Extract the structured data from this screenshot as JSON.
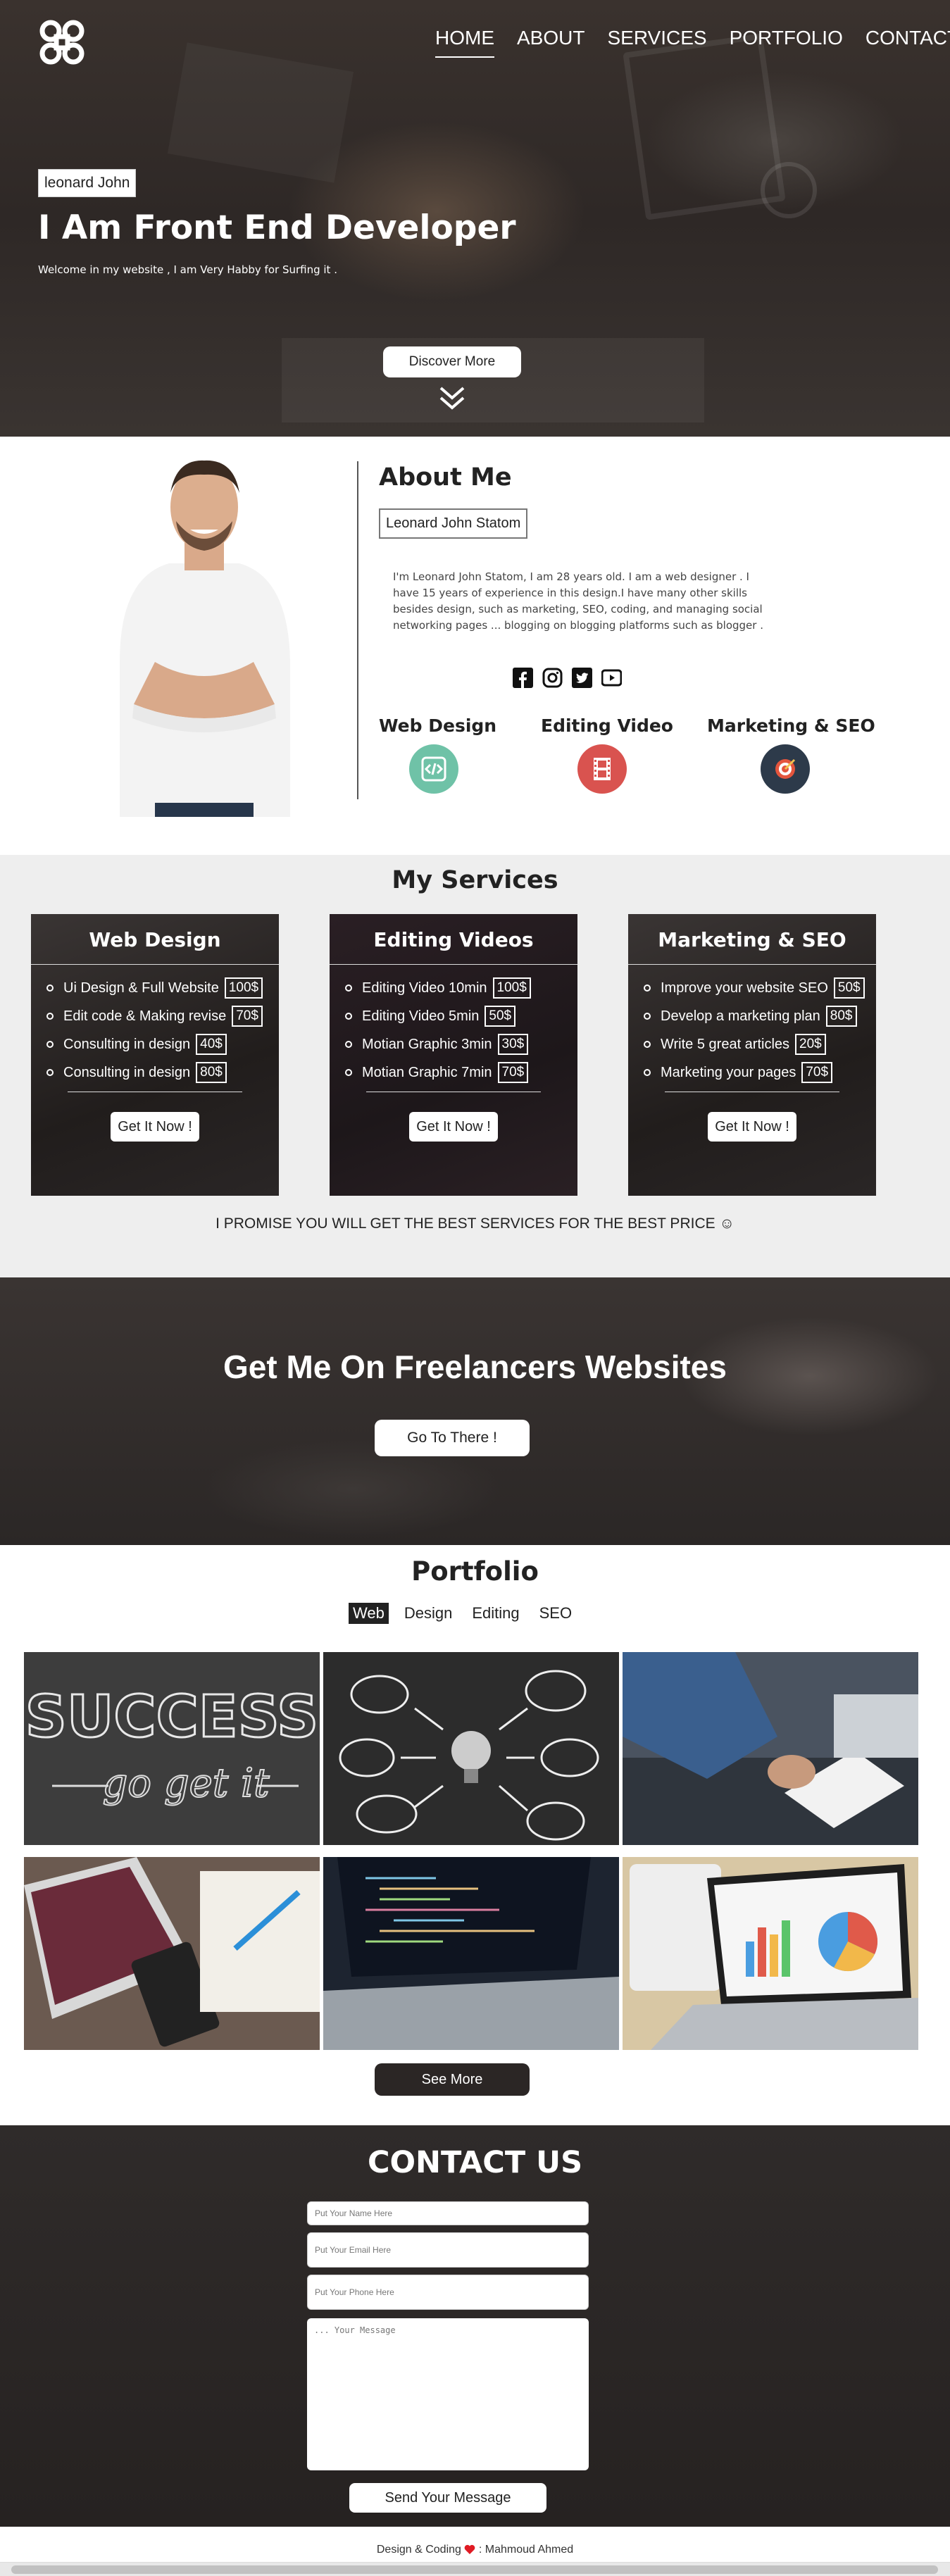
{
  "nav": {
    "items": [
      "HOME",
      "ABOUT",
      "SERVICES",
      "PORTFOLIO",
      "CONTACT"
    ],
    "active": "HOME"
  },
  "hero": {
    "name_badge": "leonard John",
    "title": "I Am Front End Developer",
    "subtitle": "Welcome in my website , I am Very Habby for Surfing it .",
    "button": "Discover More"
  },
  "about": {
    "heading": "About Me",
    "full_name": "Leonard John Statom",
    "bio": "I'm Leonard John Statom, I am 28 years old. I am a web designer . I have 15 years of experience in this design.I have many other skills besides design, such as marketing, SEO, coding, and managing social networking pages ... blogging on blogging platforms such as blogger .",
    "socials": [
      "facebook-icon",
      "instagram-icon",
      "twitter-icon",
      "youtube-icon"
    ],
    "skills": [
      {
        "label": "Web Design",
        "icon": "code-icon",
        "color": "#6fc2a7"
      },
      {
        "label": "Editing Video",
        "icon": "film-icon",
        "color": "#d9534f"
      },
      {
        "label": "Marketing & SEO",
        "icon": "target-icon",
        "color": "#2d3a4a"
      }
    ]
  },
  "services": {
    "title": "My Services",
    "cards": [
      {
        "title": "Web Design",
        "items": [
          {
            "name": "Ui Design & Full Website",
            "price": "100$"
          },
          {
            "name": "Edit code & Making revise",
            "price": "70$"
          },
          {
            "name": "Consulting in design",
            "price": "40$"
          },
          {
            "name": "Consulting in design",
            "price": "80$"
          }
        ],
        "button": "Get It Now !"
      },
      {
        "title": "Editing Videos",
        "items": [
          {
            "name": "Editing Video 10min",
            "price": "100$"
          },
          {
            "name": "Editing Video 5min",
            "price": "50$"
          },
          {
            "name": "Motian Graphic 3min",
            "price": "30$"
          },
          {
            "name": "Motian Graphic 7min",
            "price": "70$"
          }
        ],
        "button": "Get It Now !"
      },
      {
        "title": "Marketing & SEO",
        "items": [
          {
            "name": "Improve your website SEO",
            "price": "50$"
          },
          {
            "name": "Develop a marketing plan",
            "price": "80$"
          },
          {
            "name": "Write 5 great articles",
            "price": "20$"
          },
          {
            "name": "Marketing your pages",
            "price": "70$"
          }
        ],
        "button": "Get It Now !"
      }
    ],
    "promise": "I PROMISE YOU WILL GET THE BEST SERVICES FOR THE BEST PRICE ☺"
  },
  "freelance": {
    "title": "Get Me On Freelancers Websites",
    "button": "Go To There !"
  },
  "portfolio": {
    "title": "Portfolio",
    "tabs": [
      "Web",
      "Design",
      "Editing",
      "SEO"
    ],
    "active_tab": "Web",
    "chalk_word": "SUCCESS",
    "chalk_sub": "go get it",
    "button": "See More"
  },
  "contact": {
    "title": "CONTACT US",
    "name_placeholder": "Put Your Name Here",
    "email_placeholder": "Put Your Email Here",
    "phone_placeholder": "Put Your Phone Here",
    "message_placeholder": "... Your Message",
    "button": "Send Your Message"
  },
  "footer": {
    "prefix": "Design & Coding",
    "suffix": ": Mahmoud Ahmed",
    "heart_color": "#e01b24"
  }
}
